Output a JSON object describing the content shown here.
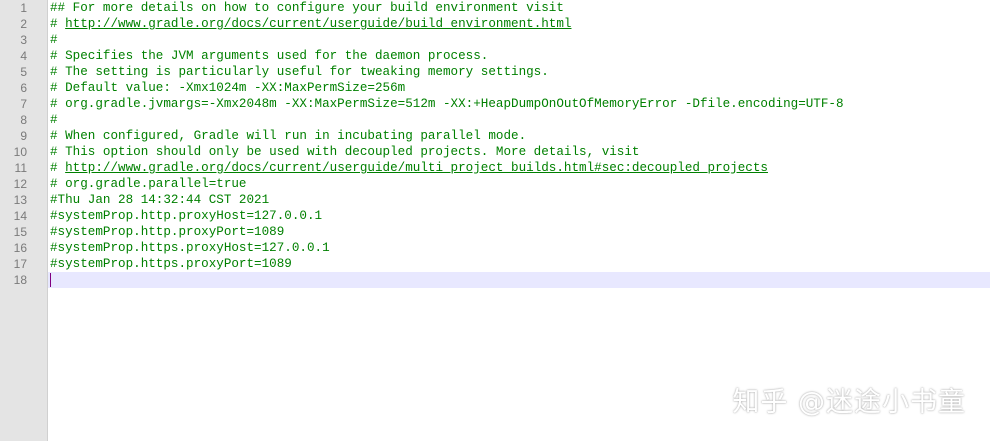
{
  "editor": {
    "line_numbers": [
      "1",
      "2",
      "3",
      "4",
      "5",
      "6",
      "7",
      "8",
      "9",
      "10",
      "11",
      "12",
      "13",
      "14",
      "15",
      "16",
      "17",
      "18"
    ],
    "lines": [
      {
        "text": "## For more details on how to configure your build environment visit"
      },
      {
        "prefix": "# ",
        "link": "http://www.gradle.org/docs/current/userguide/build_environment.html"
      },
      {
        "text": "#"
      },
      {
        "text": "# Specifies the JVM arguments used for the daemon process."
      },
      {
        "text": "# The setting is particularly useful for tweaking memory settings."
      },
      {
        "text": "# Default value: -Xmx1024m -XX:MaxPermSize=256m"
      },
      {
        "text": "# org.gradle.jvmargs=-Xmx2048m -XX:MaxPermSize=512m -XX:+HeapDumpOnOutOfMemoryError -Dfile.encoding=UTF-8"
      },
      {
        "text": "#"
      },
      {
        "text": "# When configured, Gradle will run in incubating parallel mode."
      },
      {
        "text": "# This option should only be used with decoupled projects. More details, visit"
      },
      {
        "prefix": "# ",
        "link": "http://www.gradle.org/docs/current/userguide/multi_project_builds.html#sec:decoupled_projects"
      },
      {
        "text": "# org.gradle.parallel=true"
      },
      {
        "text": "#Thu Jan 28 14:32:44 CST 2021"
      },
      {
        "text": "#systemProp.http.proxyHost=127.0.0.1"
      },
      {
        "text": "#systemProp.http.proxyPort=1089"
      },
      {
        "text": "#systemProp.https.proxyHost=127.0.0.1"
      },
      {
        "text": "#systemProp.https.proxyPort=1089"
      },
      {
        "text": ""
      }
    ],
    "current_line": 18
  },
  "watermark": "知乎 @迷途小书童",
  "colors": {
    "comment": "#008000",
    "gutter_bg": "#e4e4e4",
    "current_line_bg": "#e8e8ff",
    "caret": "#800080"
  }
}
